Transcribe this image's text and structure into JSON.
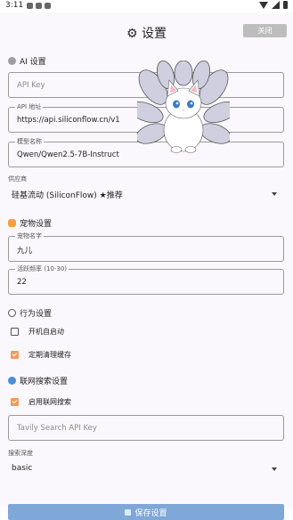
{
  "status_bar": {
    "time": "3:11"
  },
  "header": {
    "title": "⚙ 设置",
    "close_label": "关闭"
  },
  "ai_section": {
    "title": "AI 设置",
    "api_key": {
      "placeholder": "API Key"
    },
    "api_address": {
      "label": "API 地址",
      "value": "https://api.siliconflow.cn/v1"
    },
    "model_name": {
      "label": "模型名称",
      "value": "Qwen/Qwen2.5-7B-Instruct"
    },
    "provider": {
      "label": "供应商",
      "value": "硅基流动 (SiliconFlow) ★推荐"
    }
  },
  "pet_section": {
    "title": "宠物设置",
    "pet_name": {
      "label": "宠物名字",
      "value": "九儿"
    },
    "activity": {
      "label": "活跃频率 (10-30)",
      "value": "22"
    }
  },
  "behavior_section": {
    "title": "行为设置",
    "items": [
      {
        "label": "开机自启动",
        "checked": false
      },
      {
        "label": "定期清理缓存",
        "checked": true
      }
    ]
  },
  "search_section": {
    "title": "联网搜索设置",
    "enable": {
      "label": "启用联网搜索",
      "checked": true
    },
    "tavily_key": {
      "placeholder": "Tavily Search API Key"
    },
    "depth": {
      "label": "搜索深度",
      "value": "basic"
    }
  },
  "footer": {
    "save_label": "保存设置"
  },
  "colors": {
    "accent": "#f49a5a",
    "save_button": "#7fa7d8",
    "close_button": "#bdbdbd"
  }
}
